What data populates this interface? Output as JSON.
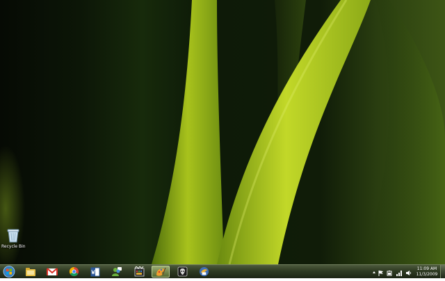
{
  "desktop": {
    "wallpaper": "green-leaf-wallpaper",
    "icons": [
      {
        "label": "Recycle Bin",
        "icon": "recycle-bin-icon"
      }
    ]
  },
  "taskbar": {
    "start_icon": "windows-orb-icon",
    "pinned": [
      {
        "app": "windows-explorer-icon"
      },
      {
        "app": "gmail-icon"
      },
      {
        "app": "chrome-icon"
      },
      {
        "app": "word-icon"
      },
      {
        "app": "messenger-icon"
      },
      {
        "app": "media-center-icon"
      },
      {
        "app": "paint-icon",
        "active": true
      },
      {
        "app": "alien-app-icon"
      },
      {
        "app": "thunderbird-icon"
      }
    ],
    "tray": [
      "show-hidden-icons-icon",
      "action-center-flag-icon",
      "battery-icon",
      "network-icon",
      "volume-icon"
    ],
    "clock": {
      "time": "11:09 AM",
      "date": "11/3/2009"
    }
  },
  "colors": {
    "accent": "#b8d21e",
    "taskbar": "#2e3a22"
  }
}
